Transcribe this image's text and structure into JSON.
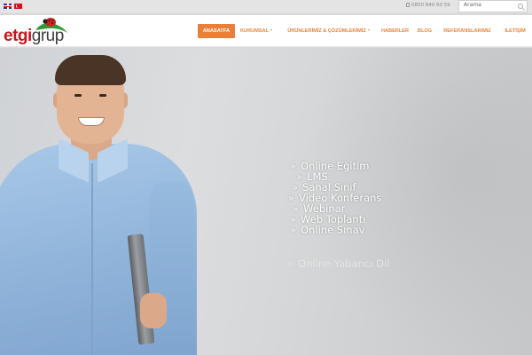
{
  "topbar": {
    "languages": [
      "English",
      "Türkçe"
    ],
    "phone": "0850 840 60 59",
    "search": {
      "placeholder": "Arama"
    }
  },
  "logo": {
    "text_etgi": "etgi",
    "text_grup": "grup"
  },
  "nav": {
    "items": [
      {
        "label": "ANASAYFA",
        "active": true,
        "dropdown": false
      },
      {
        "label": "KURUMSAL",
        "active": false,
        "dropdown": true
      },
      {
        "label": "ÜRÜNLERİMİZ & ÇÖZÜMLERİMİZ",
        "active": false,
        "dropdown": true
      },
      {
        "label": "HABERLER",
        "active": false,
        "dropdown": false
      },
      {
        "label": "BLOG",
        "active": false,
        "dropdown": false
      },
      {
        "label": "REFERANSLARIMIZ",
        "active": false,
        "dropdown": false
      },
      {
        "label": "İLETİŞİM",
        "active": false,
        "dropdown": false
      }
    ],
    "accent_color": "#ea7f37"
  },
  "hero": {
    "bullet": "»",
    "items": [
      "Online Eğitim",
      "LMS",
      "Sanal Sınıf",
      "Video Konferans",
      "Webinar",
      "Web Toplantı",
      "Online Sınav",
      "Online Yabancı Dil"
    ]
  }
}
